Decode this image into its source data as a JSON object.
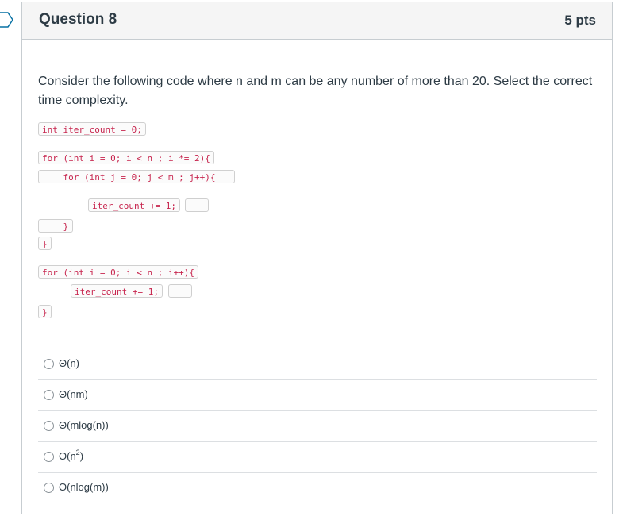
{
  "question": {
    "title": "Question 8",
    "points": "5 pts",
    "prompt": "Consider the following code where n and m can be any number of more than 20. Select the correct time complexity."
  },
  "code_lines": {
    "line1": "int iter_count = 0;",
    "line2": "for (int i = 0; i < n ; i *= 2){",
    "line3": "    for (int j = 0; j < m ; j++){",
    "line4": "iter_count += 1;",
    "line5": "    }",
    "line6": "}",
    "line7": "for (int i = 0; i < n ; i++){",
    "line8": "iter_count += 1;",
    "line9": "}"
  },
  "answers": [
    {
      "label": "Θ(n)"
    },
    {
      "label": "Θ(nm)"
    },
    {
      "label": "Θ(mlog(n))"
    },
    {
      "label_base": "Θ(n",
      "label_sup": "2",
      "label_end": ")"
    },
    {
      "label": "Θ(nlog(m))"
    }
  ]
}
